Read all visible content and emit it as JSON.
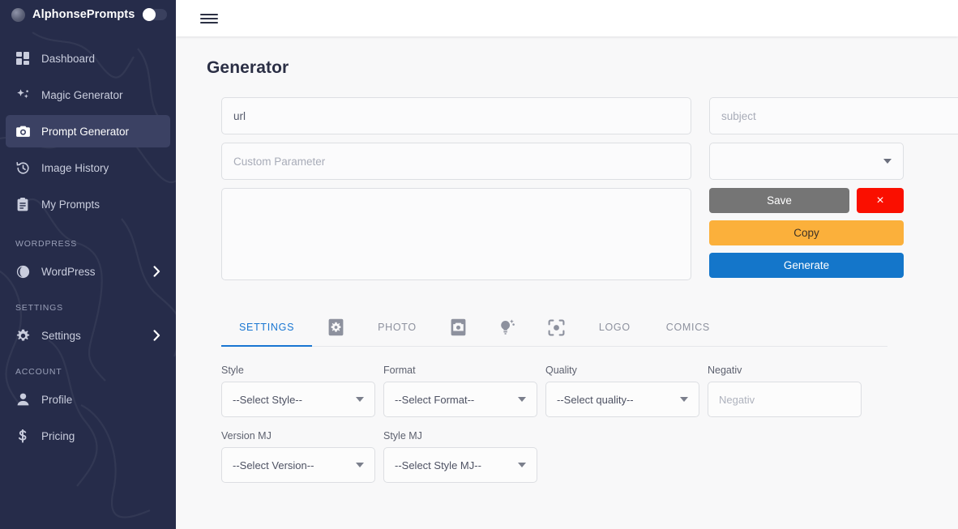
{
  "brand": {
    "title": "AlphonsePrompts",
    "logo_icon": "globe-logo-icon",
    "toggle_icon": "theme-toggle-switch"
  },
  "sidebar": {
    "items": [
      {
        "label": "Dashboard",
        "icon": "dashboard-grid-icon",
        "active": false,
        "chevron": false
      },
      {
        "label": "Magic Generator",
        "icon": "sparkles-icon",
        "active": false,
        "chevron": false
      },
      {
        "label": "Prompt Generator",
        "icon": "camera-icon",
        "active": true,
        "chevron": false
      },
      {
        "label": "Image History",
        "icon": "history-clock-icon",
        "active": false,
        "chevron": false
      },
      {
        "label": "My Prompts",
        "icon": "clipboard-icon",
        "active": false,
        "chevron": false
      }
    ],
    "sections": [
      {
        "label": "WORDPRESS",
        "items": [
          {
            "label": "WordPress",
            "icon": "wordpress-globe-icon",
            "active": false,
            "chevron": true
          }
        ]
      },
      {
        "label": "SETTINGS",
        "items": [
          {
            "label": "Settings",
            "icon": "gear-icon",
            "active": false,
            "chevron": true
          }
        ]
      },
      {
        "label": "ACCOUNT",
        "items": [
          {
            "label": "Profile",
            "icon": "person-icon",
            "active": false,
            "chevron": false
          },
          {
            "label": "Pricing",
            "icon": "dollar-icon",
            "active": false,
            "chevron": false
          }
        ]
      }
    ]
  },
  "topbar": {
    "menu_icon": "hamburger-menu-icon"
  },
  "page": {
    "title": "Generator"
  },
  "generator_form": {
    "url_value": "url",
    "url_placeholder": "url",
    "subject_placeholder": "subject",
    "custom_parameter_placeholder": "Custom Parameter",
    "model_select_value": "",
    "prompt_textarea_value": "",
    "prompt_textarea_placeholder": "",
    "buttons": {
      "save": "Save",
      "delete": "×",
      "copy": "Copy",
      "generate": "Generate"
    }
  },
  "tabs": [
    {
      "label": "SETTINGS",
      "type": "text",
      "icon": null,
      "active": true
    },
    {
      "label": "",
      "type": "icon",
      "icon": "settings-square-icon",
      "active": false
    },
    {
      "label": "PHOTO",
      "type": "text",
      "icon": null,
      "active": false
    },
    {
      "label": "",
      "type": "icon",
      "icon": "camera-icon",
      "active": false
    },
    {
      "label": "",
      "type": "icon",
      "icon": "lightbulb-sparkle-icon",
      "active": false
    },
    {
      "label": "",
      "type": "icon",
      "icon": "focus-scan-icon",
      "active": false
    },
    {
      "label": "LOGO",
      "type": "text",
      "icon": null,
      "active": false
    },
    {
      "label": "COMICS",
      "type": "text",
      "icon": null,
      "active": false
    }
  ],
  "settings_panel": {
    "row1": [
      {
        "label": "Style",
        "value": "--Select Style--",
        "kind": "select"
      },
      {
        "label": "Format",
        "value": "--Select Format--",
        "kind": "select"
      },
      {
        "label": "Quality",
        "value": "--Select quality--",
        "kind": "select"
      },
      {
        "label": "Negativ",
        "value": "",
        "placeholder": "Negativ",
        "kind": "input"
      }
    ],
    "row2": [
      {
        "label": "Version MJ",
        "value": "--Select Version--",
        "kind": "select"
      },
      {
        "label": "Style MJ",
        "value": "--Select Style MJ--",
        "kind": "select"
      }
    ]
  },
  "colors": {
    "sidebar_bg": "#262c4a",
    "sidebar_active": "#3b4163",
    "accent_blue": "#1976d2",
    "generate_blue": "#1476ca",
    "copy_orange": "#fbb03b",
    "save_gray": "#757575",
    "delete_red": "#fa0f00",
    "content_bg": "#f8f8f9"
  }
}
